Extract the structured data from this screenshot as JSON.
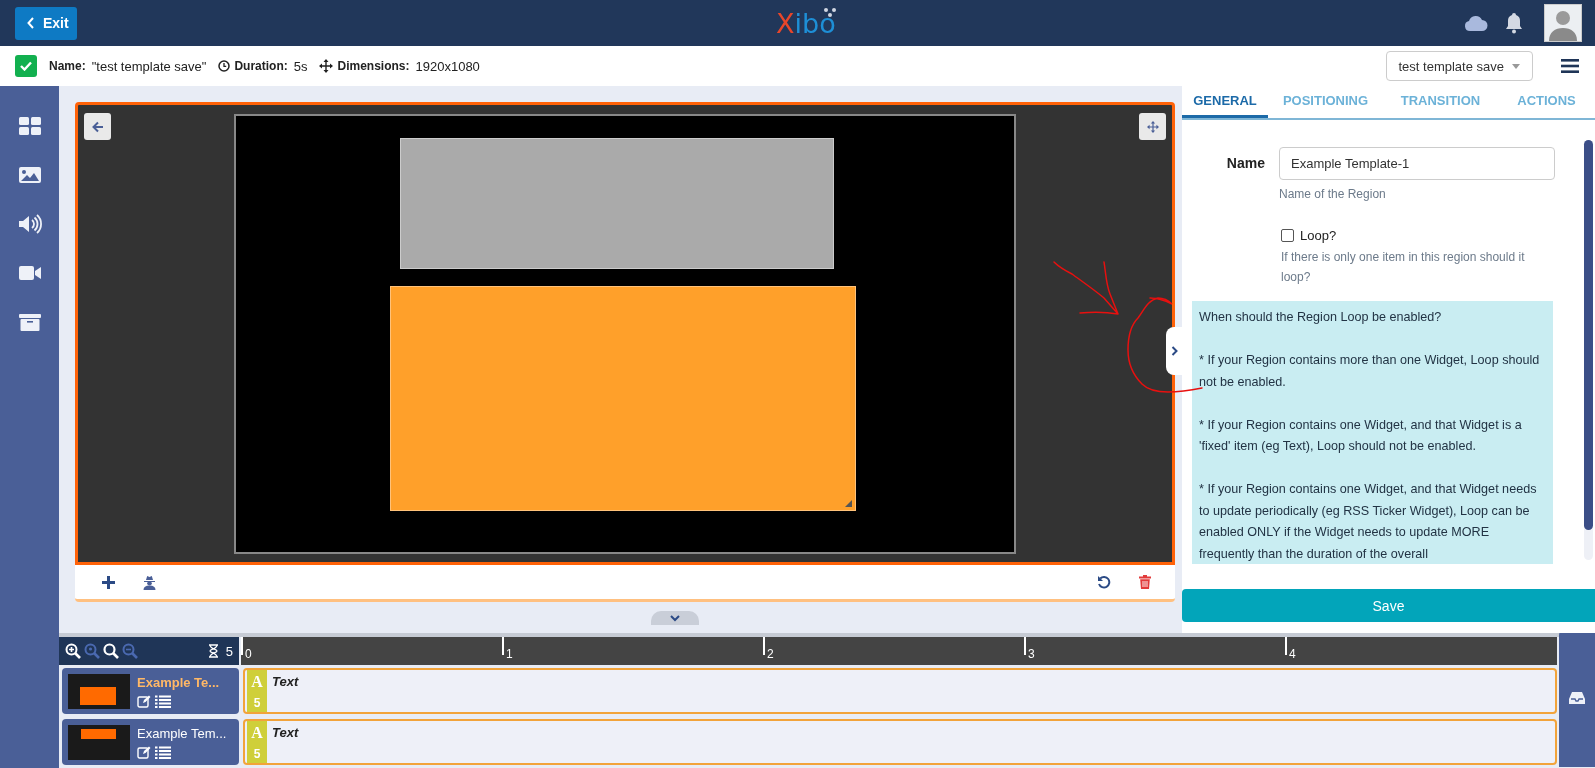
{
  "top_bar": {
    "exit_button": "Exit",
    "logo": "Xibo"
  },
  "info_bar": {
    "saved": true,
    "name_label": "Name:",
    "name_value": "\"test template save\"",
    "duration_label": "Duration:",
    "duration_value": "5s",
    "dimensions_label": "Dimensions:",
    "dimensions_value": "1920x1080",
    "layout_select": "test template save"
  },
  "layout_preview": {
    "regions": [
      {
        "selected": false
      },
      {
        "selected": true
      }
    ]
  },
  "panel": {
    "tabs": [
      {
        "label": "GENERAL",
        "selected": true
      },
      {
        "label": "POSITIONING",
        "selected": false
      },
      {
        "label": "TRANSITION",
        "selected": false
      },
      {
        "label": "ACTIONS",
        "selected": false
      }
    ],
    "name_label": "Name",
    "name_value": "Example Template-1",
    "name_help": "Name of the Region",
    "loop": {
      "label": "Loop?",
      "checked": false,
      "help": "If there is only one item in this region should it loop?"
    },
    "info_paragraphs": [
      "When should the Region Loop be enabled?",
      "* If your Region contains more than one Widget, Loop should not be enabled.",
      "* If your Region contains one Widget, and that Widget is a 'fixed' item (eg Text), Loop should not be enabled.",
      "* If your Region contains one Widget, and that Widget needs to update periodically (eg RSS Ticker Widget), Loop can be enabled ONLY if the Widget needs to update MORE frequently than the duration of the overall"
    ],
    "save_button": "Save"
  },
  "timeline": {
    "duration": "5",
    "ruler": [
      "0",
      "1",
      "2",
      "3",
      "4"
    ],
    "rows": [
      {
        "name": "Example Te...",
        "selected": true,
        "widget_letter": "A",
        "widget_duration": "5",
        "widget_name": "Text"
      },
      {
        "name": "Example Tem...",
        "selected": false,
        "widget_letter": "A",
        "widget_duration": "5",
        "widget_name": "Text"
      }
    ]
  }
}
